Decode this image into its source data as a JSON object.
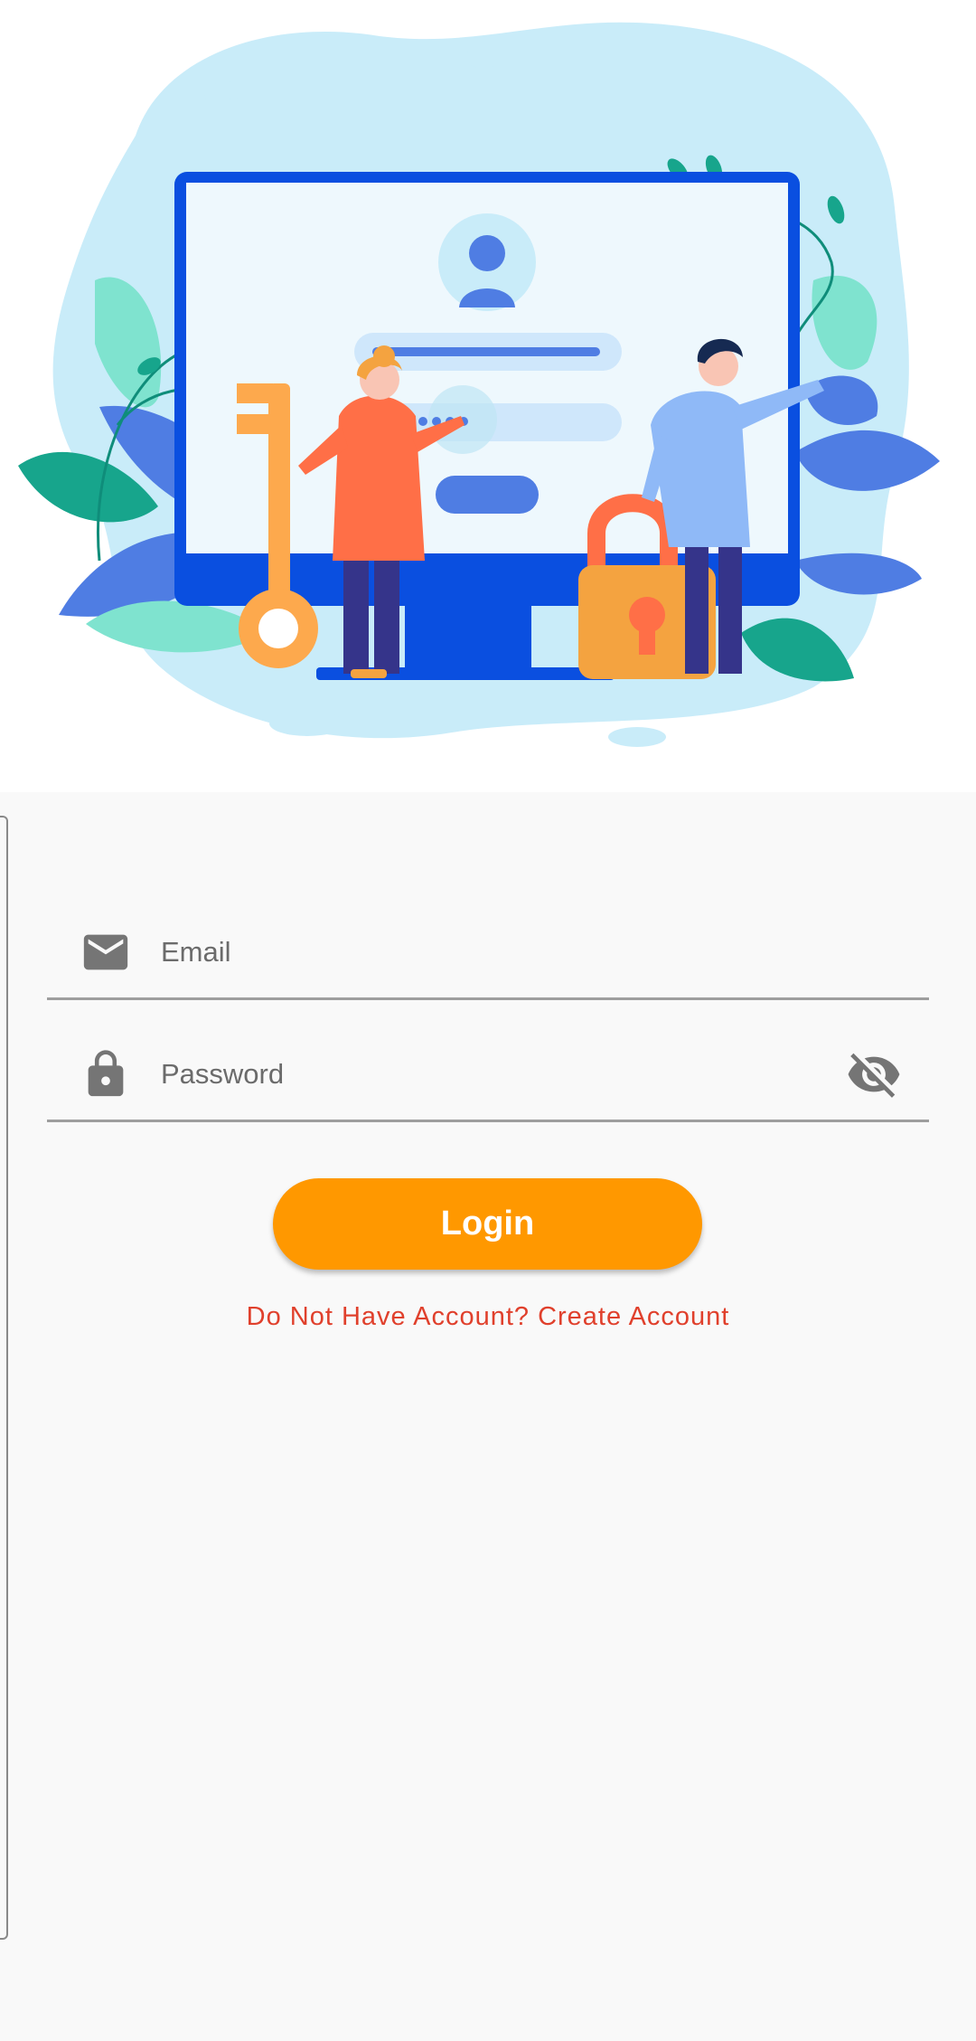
{
  "hero": {
    "illustration": "login-illustration",
    "colors": {
      "blob": "#c9ecf9",
      "monitor": "#0a4fe0",
      "key": "#fda94d",
      "lock": "#f4a340",
      "woman_shirt": "#ff6f47",
      "man_shirt": "#8fb9f7"
    }
  },
  "form": {
    "email": {
      "icon": "mail-icon",
      "placeholder": "Email",
      "value": ""
    },
    "password": {
      "icon": "lock-icon",
      "placeholder": "Password",
      "value": "",
      "toggle_icon": "visibility-off-icon"
    },
    "login_label": "Login",
    "create_account_label": "Do Not Have Account? Create Account"
  },
  "colors": {
    "accent": "#ff9800",
    "link": "#e0402c",
    "background": "#f9f9f9"
  }
}
